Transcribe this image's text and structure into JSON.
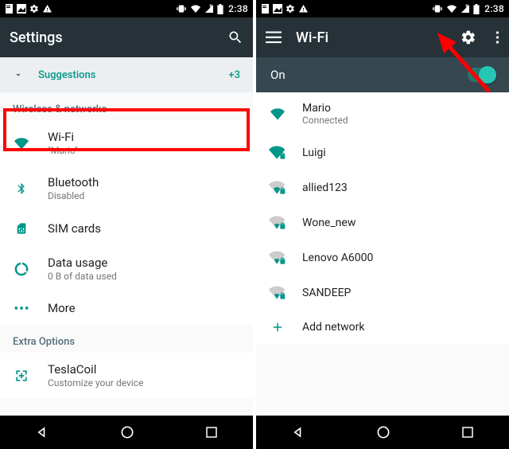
{
  "status": {
    "time": "2:38"
  },
  "left": {
    "title": "Settings",
    "suggestions_label": "Suggestions",
    "suggestions_count": "+3",
    "section_wireless": "Wireless & networks",
    "wifi_label": "Wi-Fi",
    "wifi_sub": "\"Mario\"",
    "bt_label": "Bluetooth",
    "bt_sub": "Disabled",
    "sim_label": "SIM cards",
    "data_label": "Data usage",
    "data_sub": "0 B of data used",
    "more_label": "More",
    "section_extra": "Extra Options",
    "tesla_label": "TeslaCoil",
    "tesla_sub": "Customize your device"
  },
  "right": {
    "title": "Wi-Fi",
    "on_label": "On",
    "net0_name": "Mario",
    "net0_sub": "Connected",
    "net1_name": "Luigi",
    "net2_name": "allied123",
    "net3_name": "Wone_new",
    "net4_name": "Lenovo A6000",
    "net5_name": "SANDEEP",
    "add_label": "Add network"
  }
}
